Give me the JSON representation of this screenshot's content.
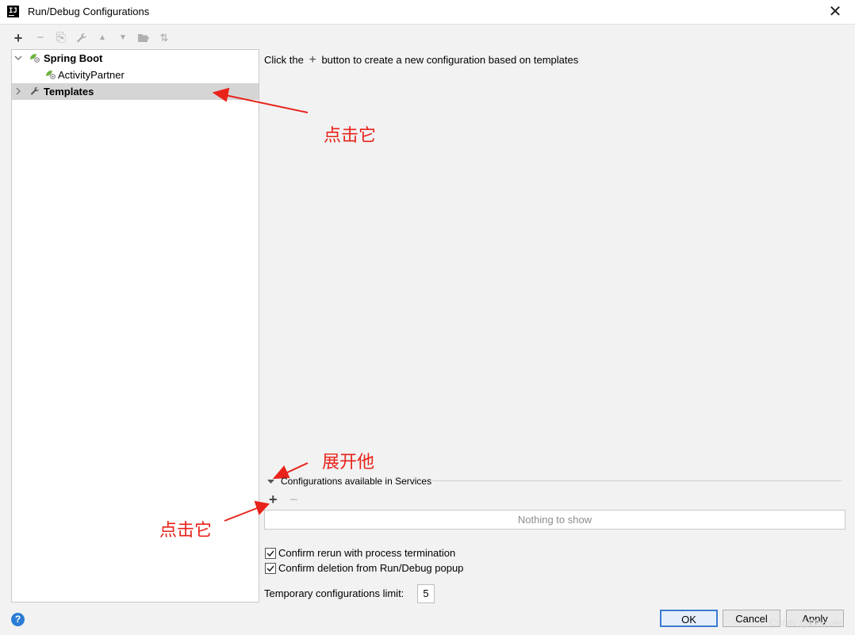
{
  "window": {
    "title": "Run/Debug Configurations",
    "app_icon_text": "IJ",
    "close_glyph": "✕"
  },
  "toolbar": {
    "add": "+",
    "remove": "−",
    "copy": "⎘",
    "edit": "🔧",
    "move_up": "▲",
    "move_down": "▼",
    "folder": "▆",
    "sort": "⇅"
  },
  "tree": {
    "items": [
      {
        "label": "Spring Boot",
        "expanded": true,
        "bold": true,
        "icon": "spring-boot-icon"
      },
      {
        "label": "ActivityPartner",
        "bold": false,
        "icon": "spring-boot-icon"
      },
      {
        "label": "Templates",
        "expanded": false,
        "bold": true,
        "selected": true,
        "icon": "wrench-icon"
      }
    ]
  },
  "main": {
    "hint_before": "Click the",
    "hint_plus": "+",
    "hint_after": "button to create a new configuration based on templates",
    "services": {
      "title": "Configurations available in Services",
      "add": "+",
      "remove": "−",
      "empty_text": "Nothing to show"
    },
    "options": {
      "confirm_rerun": "Confirm rerun with process termination",
      "confirm_rerun_checked": true,
      "confirm_deletion": "Confirm deletion from Run/Debug popup",
      "confirm_deletion_checked": true,
      "temp_limit_label": "Temporary configurations limit:",
      "temp_limit_value": "5"
    }
  },
  "annotations": {
    "click_it_top": "点击它",
    "expand_it": "展开他",
    "click_it_bottom": "点击它",
    "color": "#e8231b"
  },
  "footer": {
    "help": "?",
    "ok": "OK",
    "cancel": "Cancel",
    "apply": "Apply"
  },
  "watermark": "CSDN @Bkkcole",
  "colors": {
    "selection": "#d5d5d5",
    "accent": "#3b7bd3",
    "spring_green": "#6db33f"
  }
}
